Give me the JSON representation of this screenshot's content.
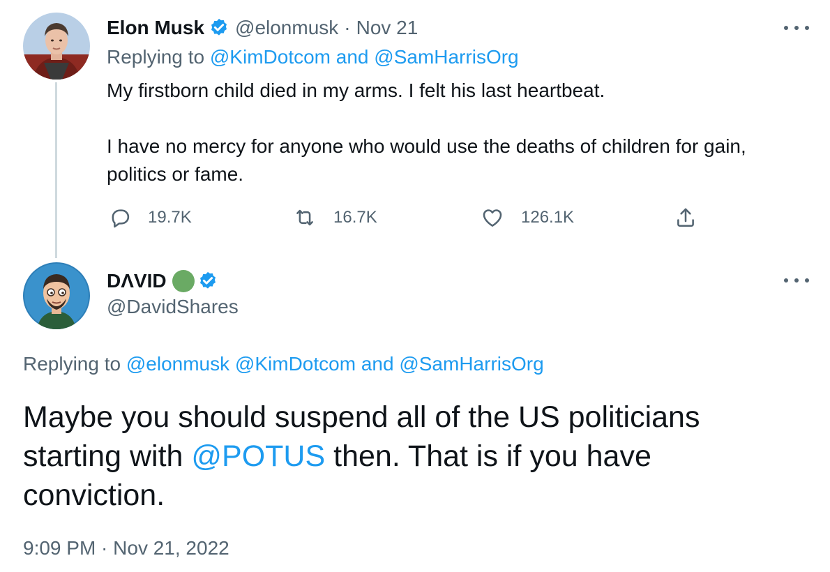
{
  "colors": {
    "link": "#1d9bf0",
    "muted": "#536471",
    "text": "#0f1419",
    "verified": "#1d9bf0",
    "status_dot": "#6aaa64"
  },
  "tweet1": {
    "author_name": "Elon Musk",
    "handle": "@elonmusk",
    "separator": "·",
    "date": "Nov 21",
    "replying_prefix": "Replying to",
    "replying_to_1": "@KimDotcom",
    "replying_and": "and",
    "replying_to_2": "@SamHarrisOrg",
    "body_line1": "My firstborn child died in my arms. I felt his last heartbeat.",
    "body_line2": "I have no mercy for anyone who would use the deaths of children for gain,",
    "body_line3": "politics or fame.",
    "replies": "19.7K",
    "retweets": "16.7K",
    "likes": "126.1K",
    "icons": {
      "reply": "reply-icon",
      "retweet": "retweet-icon",
      "like": "heart-icon",
      "share": "share-icon",
      "more": "more-icon",
      "verified": "verified-badge-icon"
    }
  },
  "tweet2": {
    "author_name": "DΛVID",
    "handle": "@DavidShares",
    "replying_prefix": "Replying to",
    "replying_to_1": "@elonmusk",
    "replying_to_2": "@KimDotcom",
    "replying_and": "and",
    "replying_to_3": "@SamHarrisOrg",
    "body_line1": "Maybe you should suspend all of the US politicians",
    "body_line2_a": "starting with",
    "body_line2_mention": "@POTUS",
    "body_line2_b": "then. That is if you have",
    "body_line3": "conviction.",
    "timestamp": "9:09 PM · Nov 21, 2022",
    "icons": {
      "status": "green-circle-icon",
      "verified": "verified-badge-icon",
      "more": "more-icon"
    }
  }
}
